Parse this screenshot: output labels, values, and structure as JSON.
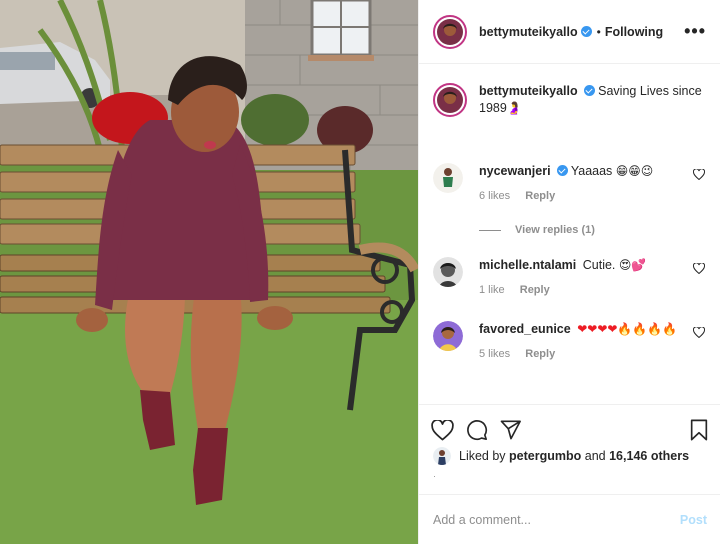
{
  "post_header": {
    "username": "bettymuteikyallo",
    "separator": "•",
    "follow_status": "Following",
    "more_label": "•••"
  },
  "caption": {
    "username": "bettymuteikyallo",
    "text": "Saving Lives since 1989",
    "emoji": "🤰"
  },
  "comments": [
    {
      "username": "nycewanjeri",
      "verified": true,
      "text": "Yaaaas",
      "emoji": "😁😁😉",
      "likes": "6 likes",
      "reply": "Reply",
      "view_replies": "View replies (1)"
    },
    {
      "username": "michelle.ntalami",
      "verified": false,
      "text": "Cutie.",
      "emoji": "😍💕",
      "likes": "1 like",
      "reply": "Reply"
    },
    {
      "username": "favored_eunice",
      "verified": false,
      "text": "",
      "emoji": "❤❤❤❤🔥🔥🔥🔥",
      "likes": "5 likes",
      "reply": "Reply"
    }
  ],
  "likes": {
    "prefix": "Liked by",
    "user": "petergumbo",
    "joiner": "and",
    "count": "16,146 others"
  },
  "timestamp": "·",
  "add_comment": {
    "placeholder": "Add a comment...",
    "post_label": "Post"
  },
  "colors": {
    "verified": "#3897f0",
    "post_button": "#b2dffc",
    "heart_emoji": "#ed1c24",
    "story_ring": "#c13584",
    "dress": "#7a2f47"
  },
  "icons": [
    "more-icon",
    "heart-icon",
    "comment-icon",
    "share-icon",
    "bookmark-icon",
    "small-heart-icon",
    "verified-badge-icon"
  ]
}
